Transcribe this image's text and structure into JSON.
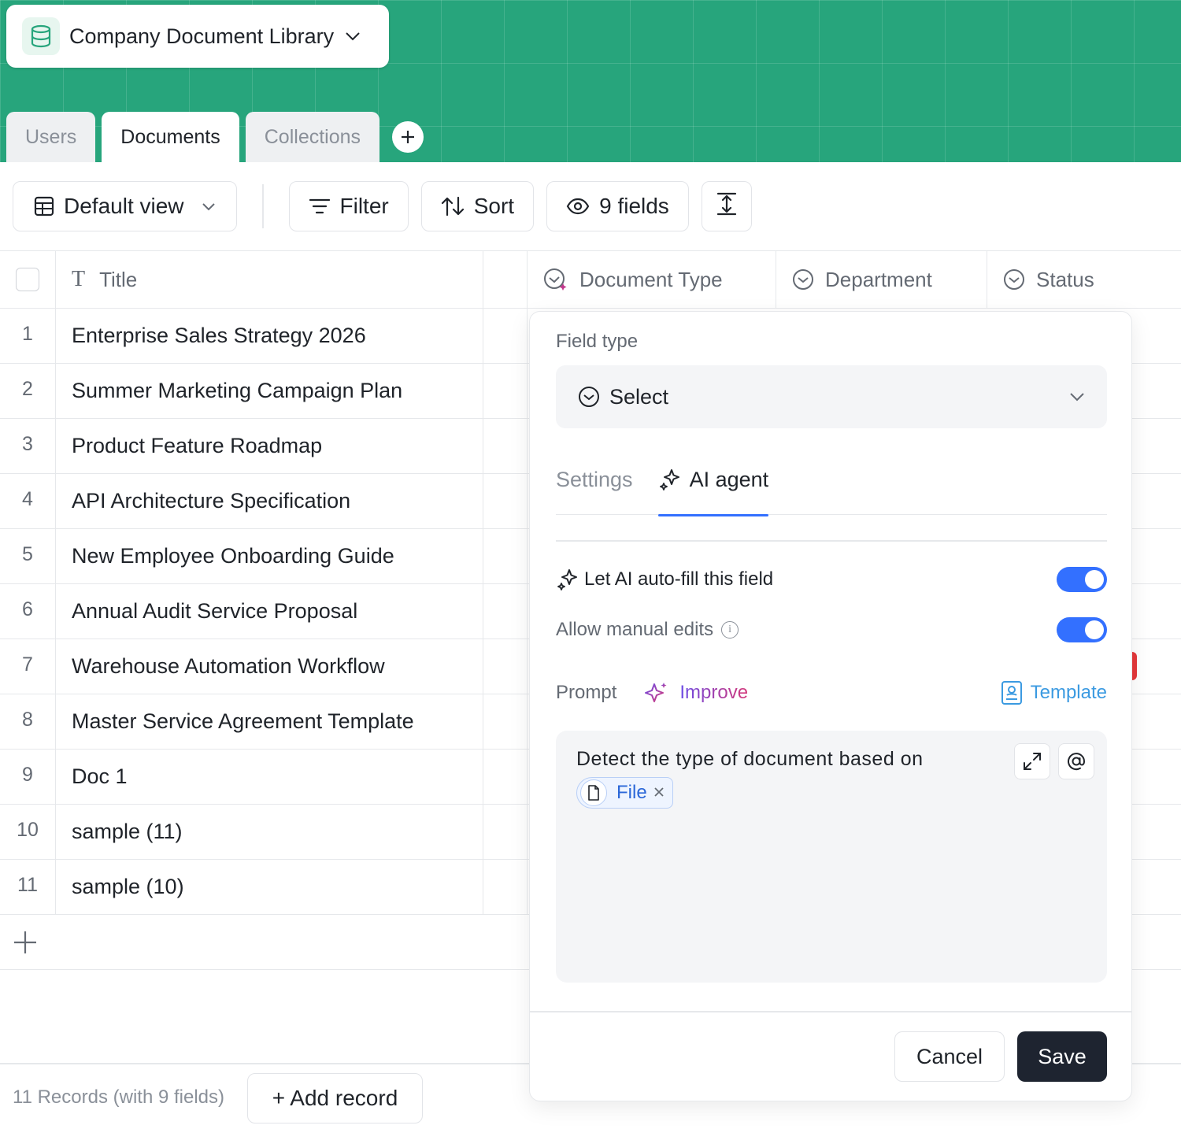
{
  "base": {
    "name": "Company Document Library"
  },
  "tabs": [
    {
      "label": "Users"
    },
    {
      "label": "Documents"
    },
    {
      "label": "Collections"
    }
  ],
  "toolbar": {
    "view_label": "Default view",
    "filter_label": "Filter",
    "sort_label": "Sort",
    "fields_label": "9 fields"
  },
  "table": {
    "columns": [
      {
        "label": "Title",
        "icon": "text-type-icon"
      },
      {
        "label": "Document Type",
        "icon": "ai-select-icon"
      },
      {
        "label": "Department",
        "icon": "select-icon"
      },
      {
        "label": "Status",
        "icon": "select-icon"
      }
    ],
    "rows": [
      {
        "num": "1",
        "title": "Enterprise Sales Strategy 2026"
      },
      {
        "num": "2",
        "title": "Summer Marketing Campaign Plan"
      },
      {
        "num": "3",
        "title": "Product Feature Roadmap"
      },
      {
        "num": "4",
        "title": "API Architecture Specification"
      },
      {
        "num": "5",
        "title": "New Employee Onboarding Guide"
      },
      {
        "num": "6",
        "title": "Annual Audit Service Proposal"
      },
      {
        "num": "7",
        "title": "Warehouse Automation Workflow"
      },
      {
        "num": "8",
        "title": "Master Service Agreement Template"
      },
      {
        "num": "9",
        "title": "Doc 1"
      },
      {
        "num": "10",
        "title": "sample (11)"
      },
      {
        "num": "11",
        "title": "sample (10)"
      }
    ]
  },
  "footer": {
    "records": "11 Records (with 9 fields)",
    "add_record": "+ Add record"
  },
  "panel": {
    "field_type_label": "Field type",
    "field_type_value": "Select",
    "tabs": {
      "settings": "Settings",
      "ai_agent": "AI agent"
    },
    "autofill_label": "Let AI auto-fill this field",
    "autofill_on": true,
    "manual_edits_label": "Allow manual edits",
    "manual_edits_on": true,
    "prompt_label": "Prompt",
    "improve_label": "Improve",
    "template_label": "Template",
    "prompt_text": "Detect the type of document based on",
    "file_chip": "File",
    "cancel": "Cancel",
    "save": "Save"
  },
  "colors": {
    "header_green": "#27a57c",
    "accent_blue": "#3370ff",
    "save_dark": "#1e2430"
  }
}
